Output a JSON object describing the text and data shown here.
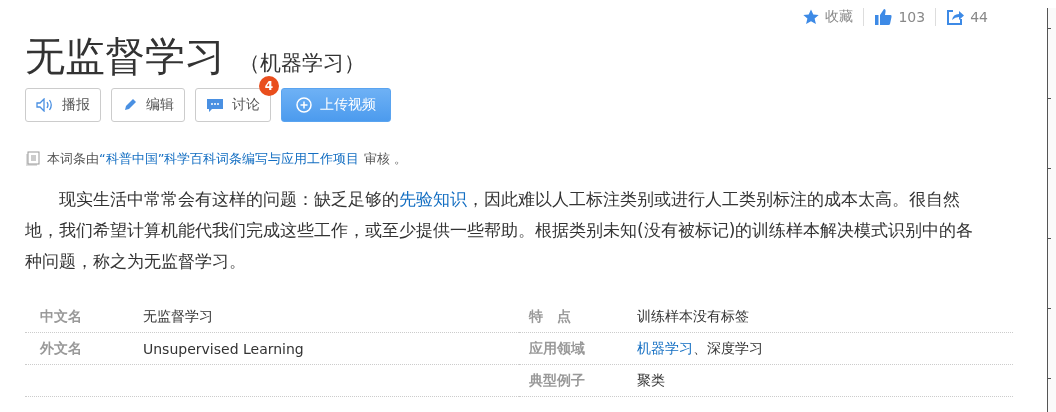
{
  "header_actions": {
    "favorite": "收藏",
    "likes": "103",
    "shares": "44"
  },
  "title": "无监督学习",
  "subtitle": "（机器学习）",
  "buttons": [
    {
      "kind": "speaker",
      "label": "播报"
    },
    {
      "kind": "edit",
      "label": "编辑"
    },
    {
      "kind": "discuss",
      "label": "讨论",
      "badge": "4"
    },
    {
      "kind": "upload",
      "label": "上传视频"
    }
  ],
  "review_note": [
    {
      "kind": "text",
      "text": "本词条由"
    },
    {
      "kind": "link",
      "text": "“科普中国”科学百科词条编写与应用工作项目"
    },
    {
      "kind": "text",
      "text": " 审核 。"
    }
  ],
  "summary": [
    {
      "kind": "text",
      "text": "现实生活中常常会有这样的问题：缺乏足够的"
    },
    {
      "kind": "link",
      "text": "先验知识"
    },
    {
      "kind": "text",
      "text": "，因此难以人工标注类别或进行人工类别标注的成本太高。很自然地，我们希望计算机能代我们完成这些工作，或至少提供一些帮助。根据类别未知(没有被标记)的训练样本解决模式识别中的各种问题，称之为无监督学习。"
    }
  ],
  "info_left": [
    {
      "label": "中文名",
      "value": [
        {
          "kind": "text",
          "text": "无监督学习"
        }
      ]
    },
    {
      "label": "外文名",
      "value": [
        {
          "kind": "text",
          "text": "Unsupervised Learning"
        }
      ]
    }
  ],
  "info_right": [
    {
      "label": "特　点",
      "value": [
        {
          "kind": "text",
          "text": "训练样本没有标签"
        }
      ]
    },
    {
      "label": "应用领域",
      "value": [
        {
          "kind": "link",
          "text": "机器学习"
        },
        {
          "kind": "text",
          "text": "、深度学习"
        }
      ]
    },
    {
      "label": "典型例子",
      "value": [
        {
          "kind": "text",
          "text": "聚类"
        }
      ]
    }
  ]
}
